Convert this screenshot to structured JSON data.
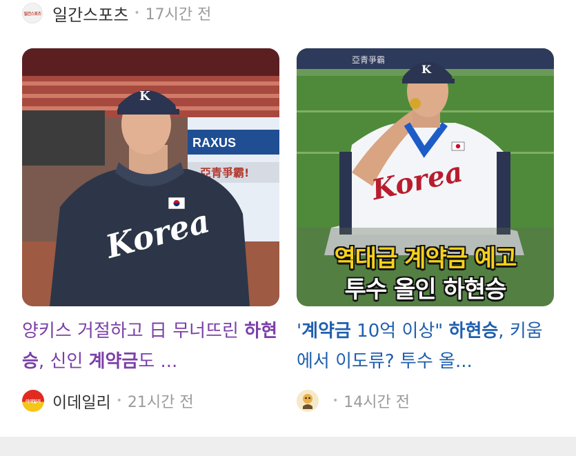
{
  "top_source": {
    "name": "일간스포츠",
    "time": "17시간 전",
    "logo_text": "일간스포츠",
    "logo_icon": "ilgan-sports-logo-icon"
  },
  "articles": [
    {
      "headline_parts": [
        "양키스 거절하고 日 무너뜨린 ",
        "하현승",
        ", 신인 ",
        "계약금",
        "도 ..."
      ],
      "source": "이데일리",
      "source_logo_text": "이데일리",
      "time": "21시간 전",
      "image": {
        "description_icon": "player-photo-icon",
        "jersey_text": "Korea",
        "board_text_1": "RAXUS",
        "board_text_2": "亞青爭霸!"
      },
      "headline_color": "#7b3fa8"
    },
    {
      "headline_parts": [
        "'",
        "계약금",
        " 10억 이상\" ",
        "하현승",
        ", 키움에서 이도류? 투수 올..."
      ],
      "source": "",
      "time": "14시간 전",
      "image": {
        "description_icon": "player-medal-photo-icon",
        "jersey_text": "Korea",
        "overlay_line_1": "역대급 계약금 예고",
        "overlay_line_2": "투수 올인 하현승",
        "board_text": "亞青爭霸"
      },
      "headline_color": "#1f5fae"
    }
  ],
  "colors": {
    "headline_left": "#7b3fa8",
    "headline_right": "#1f5fae",
    "meta_gray": "#9a9a9a",
    "bottom_bar": "#eeeeee"
  }
}
